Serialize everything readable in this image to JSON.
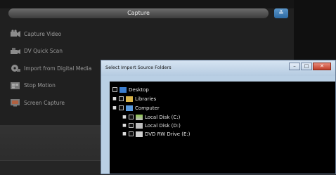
{
  "capture": {
    "title": "Capture",
    "expand_icon": "double-chevron-down-icon",
    "menu": [
      {
        "label": "Capture Video",
        "icon": "video-camera-icon"
      },
      {
        "label": "DV Quick Scan",
        "icon": "dv-camcorder-icon"
      },
      {
        "label": "Import from Digital Media",
        "icon": "digital-media-icon"
      },
      {
        "label": "Stop Motion",
        "icon": "stop-motion-icon"
      },
      {
        "label": "Screen Capture",
        "icon": "screen-capture-icon"
      }
    ]
  },
  "dialog": {
    "title": "Select Import Source Folders",
    "buttons": {
      "minimize": "–",
      "maximize": "□",
      "close": "✕"
    },
    "tree": [
      {
        "label": "Desktop",
        "icon": "desktop-icon",
        "expander": ""
      },
      {
        "label": "Libraries",
        "icon": "libraries-icon",
        "expander": "■"
      },
      {
        "label": "Computer",
        "icon": "computer-icon",
        "expander": "■"
      },
      {
        "label": "Local Disk (C:)",
        "icon": "drive-c-icon",
        "expander": "■"
      },
      {
        "label": "Local Disk (D:)",
        "icon": "drive-d-icon",
        "expander": "■"
      },
      {
        "label": "DVD RW Drive (E:)",
        "icon": "dvd-drive-icon",
        "expander": "■"
      }
    ]
  },
  "colors": {
    "accent": "#2d6aa3",
    "panel_bg": "#202020",
    "dialog_frame": "#b9cfe4"
  }
}
